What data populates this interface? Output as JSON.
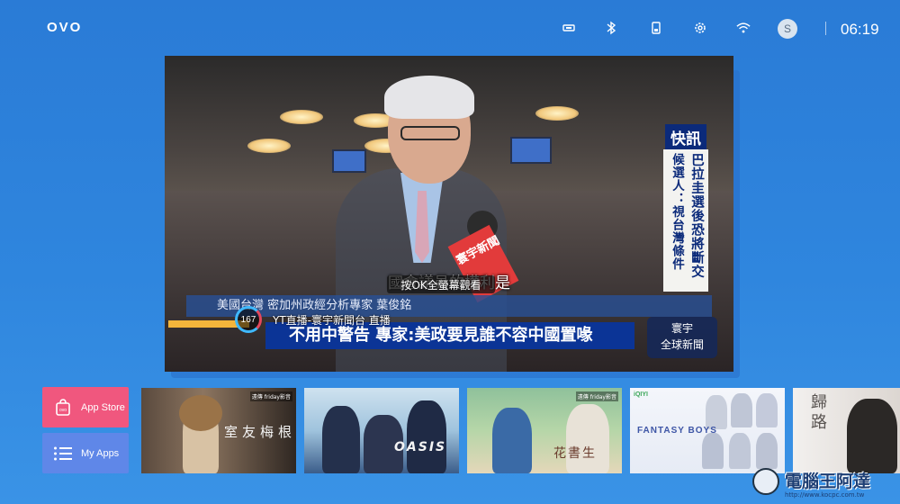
{
  "topbar": {
    "logo": "OVO",
    "time": "06:19",
    "avatar_initial": "S",
    "icons": [
      "hdmi-icon",
      "bluetooth-icon",
      "storage-icon",
      "settings-gear-icon",
      "wifi-icon",
      "user-avatar"
    ]
  },
  "player": {
    "subtitle": "國會議員的權利是",
    "ok_hint": "按OK全螢幕觀看",
    "breaking_label": "快訊",
    "breaking_line1": "巴拉圭選後恐將斷交",
    "breaking_line2": "候選人：視台灣條件",
    "ticker_top": "美國台灣    密加州政經分析專家   葉俊銘",
    "ticker_headline": "不用中警告 專家:美政要見誰不容中國置喙",
    "channel_tag_line1": "寰宇",
    "channel_tag_line2": "全球新聞",
    "channel_number": "167",
    "channel_name": "YT直播-寰宇新聞台 直播",
    "mic_label": "寰宇新聞"
  },
  "apps": {
    "app_store": "App Store",
    "my_apps": "My Apps"
  },
  "posters": [
    {
      "title": "室友梅根",
      "badge": "遠傳 friday影音"
    },
    {
      "title": "OASIS",
      "badge": ""
    },
    {
      "title": "花書生",
      "badge": "遠傳 friday影音"
    },
    {
      "title": "FANTASY BOYS",
      "badge": "iQIYI"
    },
    {
      "title": "歸路",
      "badge": ""
    }
  ],
  "watermark": {
    "text": "電腦王阿達",
    "url": "http://www.kocpc.com.tw"
  },
  "colors": {
    "background": "#2f86de",
    "app_store_tile": "#f0577e",
    "my_apps_tile": "#5f87e8",
    "news_banner": "#0b3496"
  }
}
